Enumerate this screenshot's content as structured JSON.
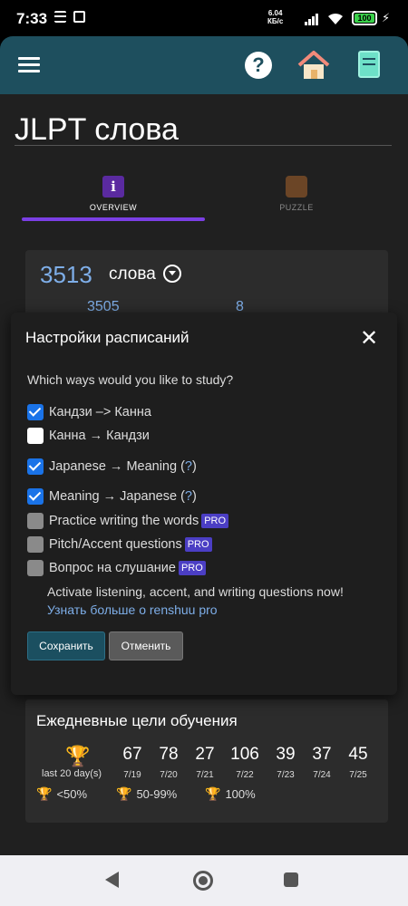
{
  "status_bar": {
    "time": "7:33",
    "net_speed": "6.04",
    "net_unit": "КБ/с",
    "battery": "100"
  },
  "app_bar": {
    "menu_icon": "hamburger-icon",
    "help_icon": "help-icon",
    "home_icon": "home-icon",
    "book_icon": "book-icon"
  },
  "page": {
    "title": "JLPT слова"
  },
  "tabs": [
    {
      "label": "OVERVIEW",
      "icon": "info-icon",
      "active": true
    },
    {
      "label": "PUZZLE",
      "icon": "puzzle-icon",
      "active": false
    }
  ],
  "words": {
    "count": "3513",
    "label": "слова",
    "sub_value_1": "3505",
    "sub_value_2": "8"
  },
  "modal": {
    "title": "Настройки расписаний",
    "question": "Which ways would you like to study?",
    "options": [
      {
        "label": "Кандзи –> Канна",
        "checked": true
      },
      {
        "label": "Канна → Кандзи",
        "checked": false
      },
      {
        "label": "Japanese → Meaning (",
        "link": "?",
        "suffix": ")",
        "checked": true
      },
      {
        "label": "Meaning → Japanese (",
        "link": "?",
        "suffix": ")",
        "checked": true
      },
      {
        "label": "Practice writing the words",
        "pro": "PRO",
        "checked": false
      },
      {
        "label": "Pitch/Accent questions",
        "pro": "PRO",
        "checked": false
      },
      {
        "label": "Вопрос на слушание",
        "pro": "PRO",
        "checked": false
      }
    ],
    "promo_text": "Activate listening, accent, and writing questions now!",
    "promo_link": "Узнать больше о renshuu pro",
    "save_label": "Сохранить",
    "cancel_label": "Отменить"
  },
  "goals": {
    "title": "Ежедневные цели обучения",
    "last_days_label": "last 20 day(s)",
    "days": [
      {
        "value": "67",
        "date": "7/19"
      },
      {
        "value": "78",
        "date": "7/20"
      },
      {
        "value": "27",
        "date": "7/21"
      },
      {
        "value": "106",
        "date": "7/22"
      },
      {
        "value": "39",
        "date": "7/23"
      },
      {
        "value": "37",
        "date": "7/24"
      },
      {
        "value": "45",
        "date": "7/25"
      }
    ],
    "legend": [
      {
        "label": "<50%",
        "color": "#b08560"
      },
      {
        "label": "50-99%",
        "color": "#e6e6e6"
      },
      {
        "label": "100%",
        "color": "#f5c518"
      }
    ]
  },
  "colors": {
    "app_bar": "#1e4f5e",
    "accent": "#7b3fe4",
    "link": "#7eaee8",
    "checkbox": "#1a73e8",
    "pro_badge": "#4b3ec4"
  }
}
